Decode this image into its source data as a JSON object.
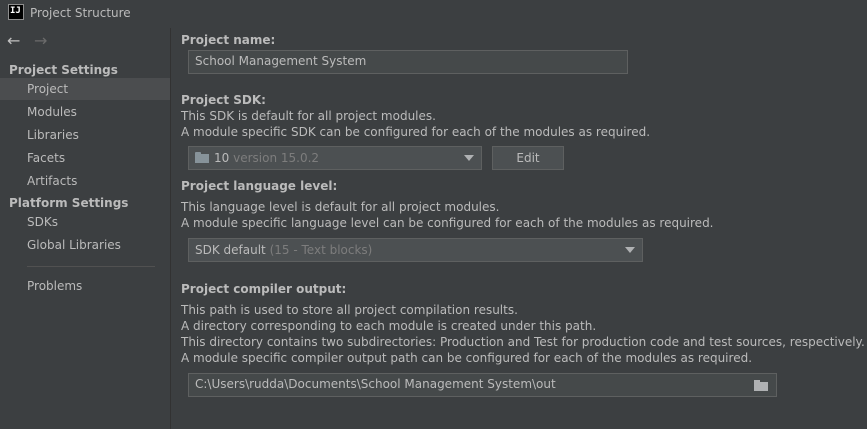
{
  "window": {
    "app_icon_text": "IJ",
    "title": "Project Structure"
  },
  "nav": {
    "back": "←",
    "forward": "→"
  },
  "sidebar": {
    "project_settings_header": "Project Settings",
    "project_settings": [
      {
        "label": "Project",
        "selected": true
      },
      {
        "label": "Modules"
      },
      {
        "label": "Libraries"
      },
      {
        "label": "Facets"
      },
      {
        "label": "Artifacts"
      }
    ],
    "platform_settings_header": "Platform Settings",
    "platform_settings": [
      {
        "label": "SDKs"
      },
      {
        "label": "Global Libraries"
      }
    ],
    "problems": "Problems"
  },
  "project": {
    "name_label": "Project name:",
    "name_value": "School Management System",
    "sdk_label": "Project SDK:",
    "sdk_desc1": "This SDK is default for all project modules.",
    "sdk_desc2": "A module specific SDK can be configured for each of the modules as required.",
    "sdk_value": "10",
    "sdk_version": "version 15.0.2",
    "edit_button": "Edit",
    "lang_label": "Project language level:",
    "lang_desc1": "This language level is default for all project modules.",
    "lang_desc2": "A module specific language level can be configured for each of the modules as required.",
    "lang_value": "SDK default",
    "lang_detail": "(15 - Text blocks)",
    "output_label": "Project compiler output:",
    "output_desc1": "This path is used to store all project compilation results.",
    "output_desc2": "A directory corresponding to each module is created under this path.",
    "output_desc3": "This directory contains two subdirectories: Production and Test for production code and test sources, respectively.",
    "output_desc4": "A module specific compiler output path can be configured for each of the modules as required.",
    "output_value": "C:\\Users\\rudda\\Documents\\School Management System\\out"
  },
  "colors": {
    "background": "#3c3f41",
    "selected": "#4b4d4f",
    "field": "#45494a"
  }
}
